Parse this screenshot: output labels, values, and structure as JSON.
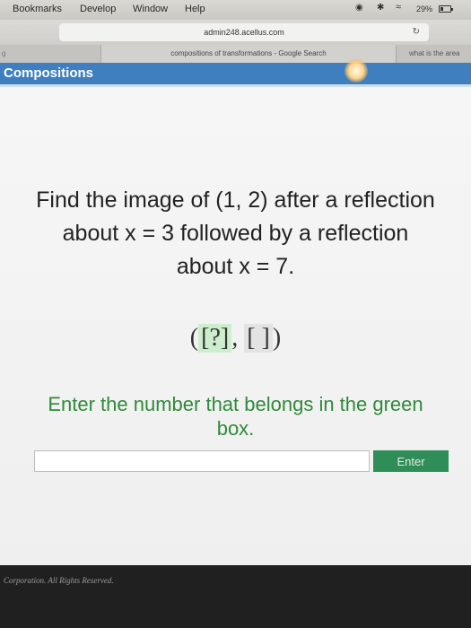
{
  "menubar": {
    "items": [
      "Bookmarks",
      "Develop",
      "Window",
      "Help"
    ],
    "battery_text": "29%",
    "battery_level": 0.29
  },
  "browser": {
    "url": "admin248.acellus.com",
    "tabs": {
      "active": "compositions of transformations - Google Search",
      "right": "what is the area"
    }
  },
  "app": {
    "title": "Compositions"
  },
  "problem": {
    "question": "Find the image of (1, 2) after a reflection about x = 3 followed by a reflection about x = 7.",
    "template": {
      "open": "(",
      "box1": "[?]",
      "separator": ", ",
      "box2": "[ ]",
      "close": ")"
    },
    "prompt": "Enter the number that belongs in the green box.",
    "input_value": "",
    "button_label": "Enter"
  },
  "footer": {
    "copyright": "Corporation. All Rights Reserved."
  },
  "colors": {
    "header": "#3f7fbf",
    "prompt_text": "#2f8a3a",
    "button": "#2f8e57",
    "green_box": "#cdeecd"
  }
}
